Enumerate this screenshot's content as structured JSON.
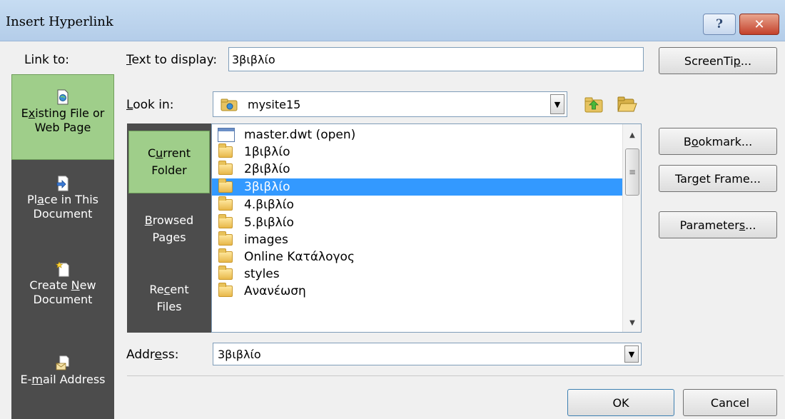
{
  "window": {
    "title": "Insert Hyperlink",
    "help_glyph": "?",
    "close_glyph": "✕"
  },
  "link_to": {
    "label": "Link to:",
    "items": [
      {
        "id": "existing",
        "pre": "E",
        "ul": "x",
        "post": "isting File or",
        "line2": "Web Page",
        "icon": "web-page-icon",
        "selected": true
      },
      {
        "id": "place",
        "pre": "Pl",
        "ul": "a",
        "post": "ce in This",
        "line2": "Document",
        "icon": "document-place-icon",
        "selected": false
      },
      {
        "id": "create",
        "line1": "Create ",
        "ul_pre": "N",
        "post": "ew",
        "line2": "Document",
        "icon": "new-document-icon",
        "selected": false
      },
      {
        "id": "email",
        "pre": "E-",
        "ul": "m",
        "post": "ail Address",
        "icon": "email-address-icon",
        "selected": false
      }
    ]
  },
  "text_to_display": {
    "label_pre": "",
    "label_ul": "T",
    "label_post": "ext to display:",
    "value": "3βιβλίο"
  },
  "screentip": {
    "pre": "ScreenTi",
    "ul": "p",
    "post": "..."
  },
  "look_in": {
    "label_pre": "",
    "label_ul": "L",
    "label_post": "ook in:",
    "value": "mysite15",
    "icon": "site-folder-icon"
  },
  "side_frame": {
    "items": [
      {
        "id": "current",
        "line1": "C",
        "ul": "u",
        "post1": "rrent",
        "line2": "Folder",
        "selected": true
      },
      {
        "id": "browsed",
        "ul_first": "B",
        "post1": "rowsed",
        "line2": "Pages",
        "selected": false
      },
      {
        "id": "recent",
        "line1": "Re",
        "ul": "c",
        "post1": "ent",
        "line2": "Files",
        "selected": false
      }
    ]
  },
  "files": [
    {
      "name": "master.dwt (open)",
      "icon": "dwt-file-icon",
      "selected": false
    },
    {
      "name": "1βιβλίο",
      "icon": "folder-icon",
      "selected": false
    },
    {
      "name": "2βιβλίο",
      "icon": "folder-icon",
      "selected": false
    },
    {
      "name": "3βιβλίο",
      "icon": "folder-icon",
      "selected": true
    },
    {
      "name": "4.βιβλίο",
      "icon": "folder-icon",
      "selected": false
    },
    {
      "name": "5.βιβλίο",
      "icon": "folder-icon",
      "selected": false
    },
    {
      "name": "images",
      "icon": "folder-icon",
      "selected": false
    },
    {
      "name": "Online Κατάλογος",
      "icon": "folder-icon",
      "selected": false
    },
    {
      "name": "styles",
      "icon": "folder-icon",
      "selected": false
    },
    {
      "name": "Ανανέωση",
      "icon": "folder-icon",
      "selected": false
    }
  ],
  "buttons": {
    "bookmark": {
      "pre": "B",
      "ul": "o",
      "post": "okmark..."
    },
    "target_frame": {
      "pre": "Tar",
      "ul": "g",
      "post": "et Frame..."
    },
    "parameters": {
      "pre": "Parameter",
      "ul": "s",
      "post": "..."
    },
    "ok": "OK",
    "cancel": "Cancel"
  },
  "address": {
    "label_pre": "Addr",
    "label_ul": "e",
    "label_post": "ss:",
    "value": "3βιβλίο"
  },
  "colors": {
    "selected_green": "#9fce8a",
    "dark_panel": "#4c4c4c",
    "selection_blue": "#3399ff"
  }
}
